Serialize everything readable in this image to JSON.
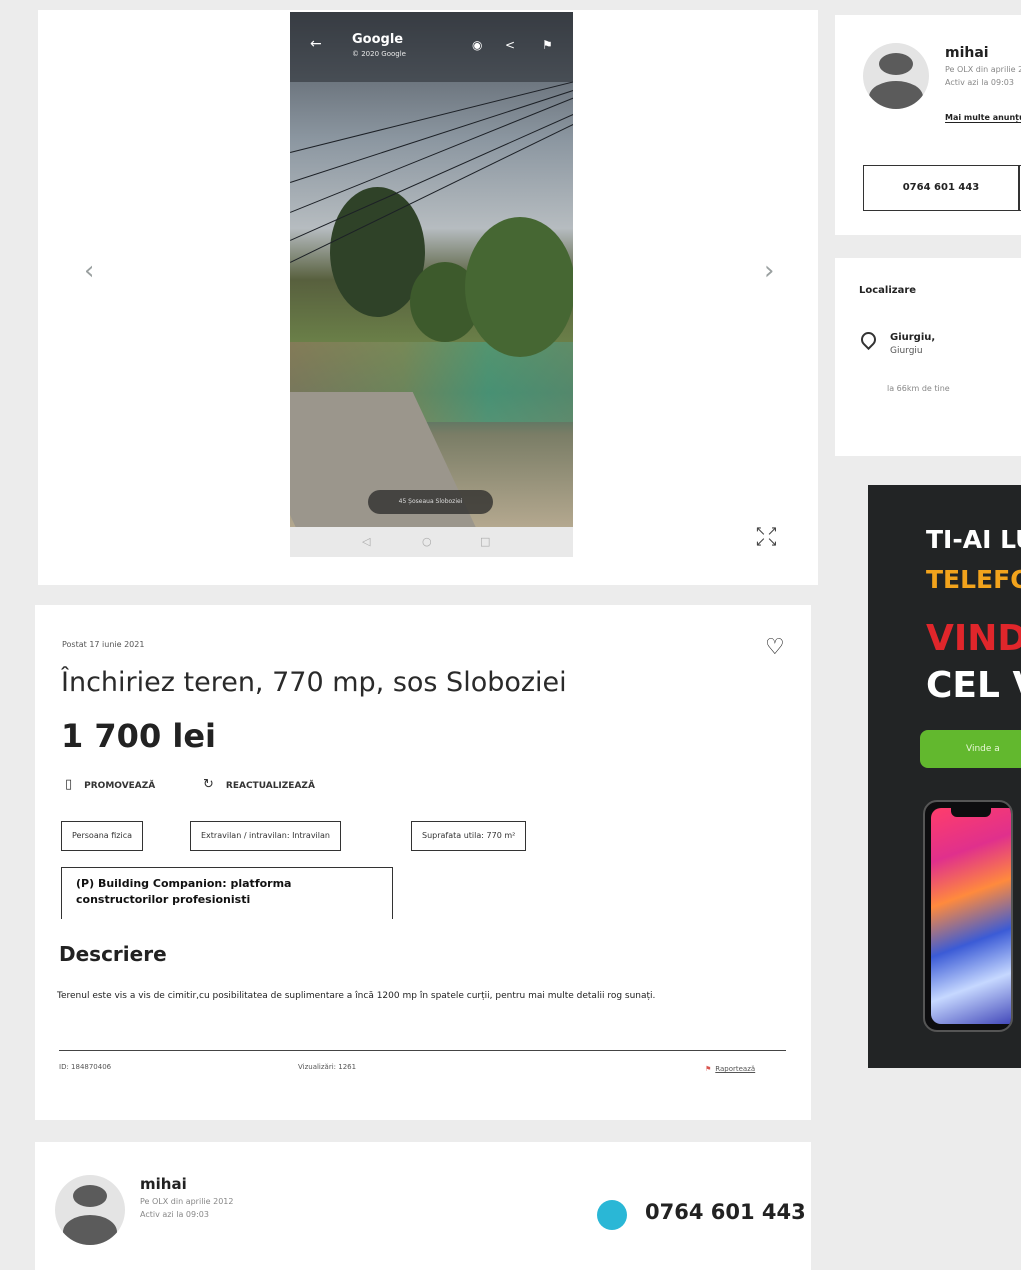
{
  "gallery": {
    "photo_title": "Google",
    "photo_subtitle": "© 2020 Google",
    "street_label": "45 Șoseaua Sloboziei",
    "prev_glyph": "‹",
    "next_glyph": "›"
  },
  "listing": {
    "posted": "Postat 17 iunie 2021",
    "title": "Închiriez teren, 770 mp, sos Sloboziei",
    "price": "1 700 lei",
    "actions": {
      "promote": "PROMOVEAZĂ",
      "refresh": "REACTUALIZEAZĂ"
    },
    "tags": [
      "Persoana fizica",
      "Extravilan / intravilan: Intravilan",
      "Suprafata utila: 770 m²"
    ],
    "company_banner": "(P) Building Companion: platforma constructorilor profesionisti",
    "description_heading": "Descriere",
    "description": "Terenul este vis a vis de cimitir,cu posibilitatea de suplimentare a încă 1200 mp în spatele curții, pentru mai multe detalii rog sunați.",
    "id_text": "ID: 184870406",
    "views_text": "Vizualizări: 1261",
    "report_text": "Raportează"
  },
  "seller": {
    "name": "mihai",
    "member_since": "Pe OLX din aprilie 2012",
    "active": "Activ azi la 09:03",
    "phone": "0764 601 443",
    "more_ads": "Mai multe anunțuri"
  },
  "location": {
    "heading": "Localizare",
    "city": "Giurgiu,",
    "region": "Giurgiu",
    "distance": "la 66km de tine"
  },
  "ad": {
    "line1": "TI-AI LU",
    "line2": "TELEFO",
    "line3": "VINDE",
    "line4": "CEL V",
    "button": "Vinde a",
    "colors": {
      "line1": "#ffffff",
      "line2": "#f2a31c",
      "line3": "#e0262b",
      "line4": "#ffffff",
      "button": "#62b82e"
    }
  },
  "icons": [
    "back-arrow-icon",
    "compass-icon",
    "share-icon",
    "flag-icon",
    "heart-icon",
    "bookmark-icon",
    "refresh-icon",
    "fullscreen-icon",
    "location-pin-icon",
    "phone-icon",
    "avatar-icon"
  ]
}
